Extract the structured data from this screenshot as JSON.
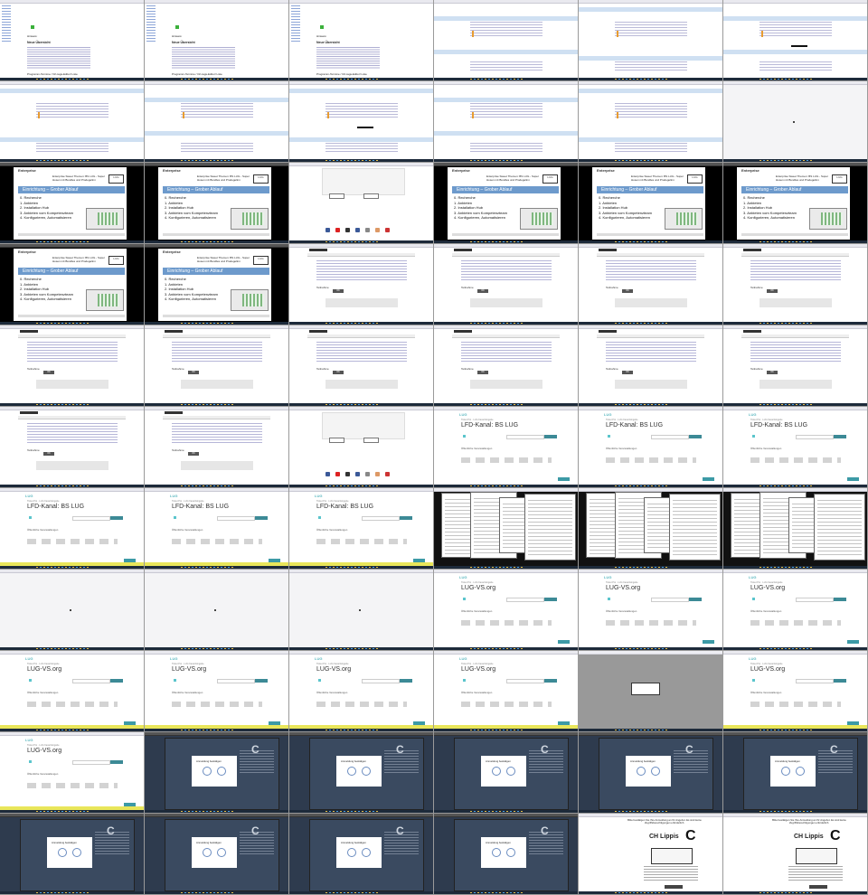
{
  "grid": {
    "columns": 6,
    "rows": 11
  },
  "texts": {
    "doc_title": "Hinweis:",
    "doc_subtitle": "Neue Übersicht",
    "doc_footer": "Programm-Termine / Ort-tags-Editor/ Liste",
    "slide_logo": "Enterprise",
    "slide_head": "Enterprise Sweet Themen: BS LUG - Super Hosen mit Bundles und Prodegelinn",
    "slide_title": "Einrichtung – Grober Ablauf",
    "slide_items": [
      "0. Recherche",
      "1. Anbieten",
      "2. Installation Hub",
      "3. Anbieten vom Kompetenzteam",
      "4. Konfigurieren, Automatisieren"
    ],
    "job_small": "Ticket Pro · LUG Kanal Eingabe",
    "job_big_1": "LFD-Kanal: BS LUG",
    "job_big_2": "LUG-VS.org",
    "job_section": "Öffentliche Veranstaltungen",
    "dialog_title": "Anmeldung bestätigen",
    "unlock_header": "Bitte bestätigen Sie Ihre Anmeldung an Ihr Angebot. Es sind keine Zugriffsberechtigungen erforderlich.",
    "unlock_logo": "CH Lippis"
  },
  "cells": [
    {
      "type": "doc"
    },
    {
      "type": "doc"
    },
    {
      "type": "doc"
    },
    {
      "type": "term"
    },
    {
      "type": "term"
    },
    {
      "type": "term"
    },
    {
      "type": "term"
    },
    {
      "type": "term"
    },
    {
      "type": "term"
    },
    {
      "type": "term"
    },
    {
      "type": "term"
    },
    {
      "type": "blank"
    },
    {
      "type": "slide"
    },
    {
      "type": "slide"
    },
    {
      "type": "social"
    },
    {
      "type": "slide"
    },
    {
      "type": "slide"
    },
    {
      "type": "slide"
    },
    {
      "type": "slide"
    },
    {
      "type": "slide"
    },
    {
      "type": "form"
    },
    {
      "type": "form"
    },
    {
      "type": "form"
    },
    {
      "type": "form"
    },
    {
      "type": "form"
    },
    {
      "type": "form"
    },
    {
      "type": "form"
    },
    {
      "type": "form"
    },
    {
      "type": "form"
    },
    {
      "type": "form"
    },
    {
      "type": "form"
    },
    {
      "type": "form"
    },
    {
      "type": "social"
    },
    {
      "type": "job"
    },
    {
      "type": "job"
    },
    {
      "type": "job"
    },
    {
      "type": "job"
    },
    {
      "type": "job"
    },
    {
      "type": "job"
    },
    {
      "type": "collage"
    },
    {
      "type": "collage"
    },
    {
      "type": "collage"
    },
    {
      "type": "blank"
    },
    {
      "type": "blank"
    },
    {
      "type": "blank"
    },
    {
      "type": "job2"
    },
    {
      "type": "job2"
    },
    {
      "type": "job2"
    },
    {
      "type": "job2"
    },
    {
      "type": "job2"
    },
    {
      "type": "job2"
    },
    {
      "type": "job2"
    },
    {
      "type": "grayd"
    },
    {
      "type": "job2"
    },
    {
      "type": "job2"
    },
    {
      "type": "dark"
    },
    {
      "type": "dark"
    },
    {
      "type": "dark"
    },
    {
      "type": "dark"
    },
    {
      "type": "dark"
    },
    {
      "type": "dark"
    },
    {
      "type": "dark"
    },
    {
      "type": "dark"
    },
    {
      "type": "dark"
    },
    {
      "type": "unlock"
    },
    {
      "type": "unlock"
    }
  ],
  "colors": {
    "accent": "#3c9aa6",
    "yellow": "#e9e65a",
    "dark_bg": "#2e3b4e",
    "slide_blue": "#6d9acc"
  }
}
